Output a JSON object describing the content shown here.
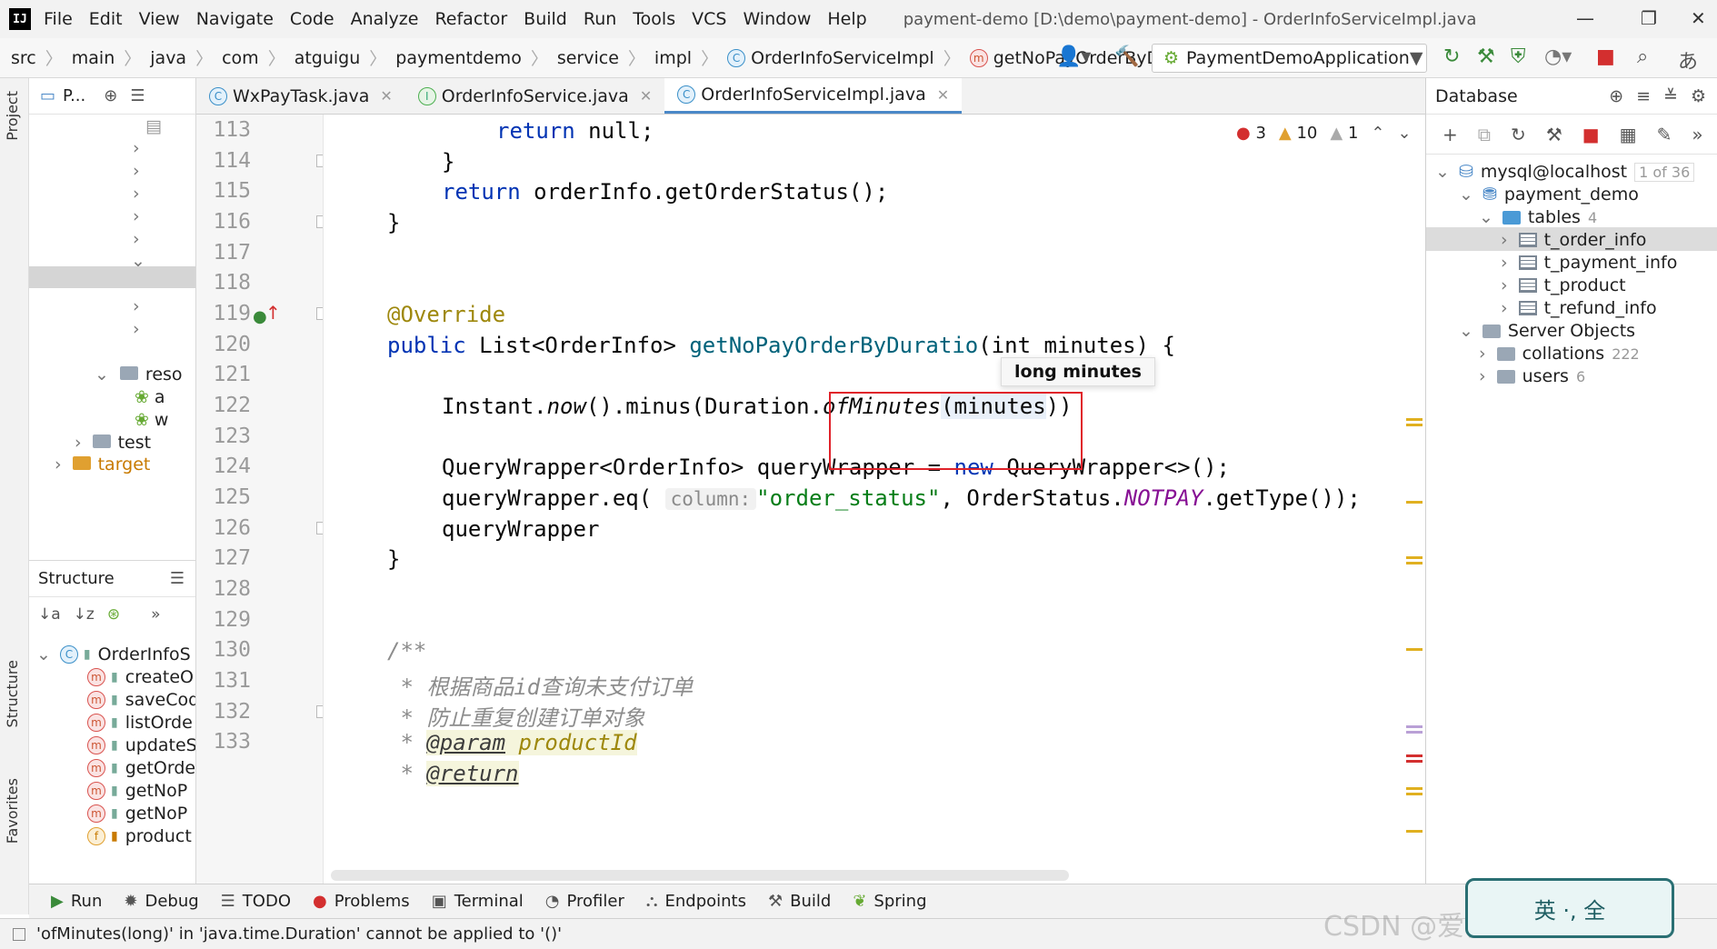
{
  "menubar": {
    "items": [
      "File",
      "Edit",
      "View",
      "Navigate",
      "Code",
      "Analyze",
      "Refactor",
      "Build",
      "Run",
      "Tools",
      "VCS",
      "Window",
      "Help"
    ],
    "title": "payment-demo [D:\\demo\\payment-demo] - OrderInfoServiceImpl.java"
  },
  "breadcrumb": [
    "src",
    "main",
    "java",
    "com",
    "atguigu",
    "paymentdemo",
    "service",
    "impl",
    "OrderInfoServiceImpl",
    "getNoPayOrderByDuration"
  ],
  "run_config": "PaymentDemoApplication",
  "project": {
    "header": "P...",
    "rows": [
      "reso",
      "a",
      "w",
      "test",
      "target"
    ]
  },
  "structure": {
    "header": "Structure",
    "class_name": "OrderInfoS",
    "members": [
      "createO",
      "saveCod",
      "listOrde",
      "updateS",
      "getOrde",
      "getNoP",
      "getNoP",
      "product"
    ]
  },
  "editor_tabs": [
    {
      "label": "WxPayTask.java",
      "badge": "C"
    },
    {
      "label": "OrderInfoService.java",
      "badge": "I"
    },
    {
      "label": "OrderInfoServiceImpl.java",
      "badge": "C"
    }
  ],
  "editor": {
    "line_numbers": [
      "113",
      "114",
      "115",
      "116",
      "117",
      "118",
      "119",
      "120",
      "121",
      "122",
      "123",
      "124",
      "125",
      "126",
      "127",
      "128",
      "129",
      "130",
      "131",
      "132",
      "133"
    ],
    "tooltip": "long minutes",
    "inspections": {
      "errors": "3",
      "warnings": "10",
      "weak": "1"
    },
    "code": {
      "l113_kw": "return",
      "l113_rest": " null;",
      "l114": "}",
      "l115_kw": "return",
      "l115_rest": " orderInfo.getOrderStatus();",
      "l116": "}",
      "l118": "@Override",
      "l119_kw": "public",
      "l119_type": " List<OrderInfo> ",
      "l119_fn": "getNoPayOrderByDuratio",
      "l119_tail": "(int minutes) {",
      "l121_a": "Instant.",
      "l121_now": "now",
      "l121_b": "().minus(Duration.",
      "l121_of": "ofMinutes",
      "l121_c": "(",
      "l121_arg": "minutes",
      "l121_d": "))",
      "l123_a": "QueryWrapper<OrderInfo> queryWrapper = ",
      "l123_kw": "new",
      "l123_b": " QueryWrapper<>();",
      "l124_a": "queryWrapper.eq( ",
      "l124_hint": "column:",
      "l124_str": "\"order_status\"",
      "l124_b": ", OrderStatus.",
      "l124_cst": "NOTPAY",
      "l124_c": ".getType());",
      "l125": "queryWrapper",
      "l126": "}",
      "l129": "/**",
      "l130": " * 根据商品id查询未支付订单",
      "l131": " * 防止重复创建订单对象",
      "l132_a": " * ",
      "l132_tag": "@param",
      "l132_b": " productId",
      "l133_a": " * ",
      "l133_tag": "@return"
    }
  },
  "database": {
    "header": "Database",
    "connection": "mysql@localhost",
    "connection_count": "1 of 36",
    "schema": "payment_demo",
    "tables_label": "tables",
    "tables_count": "4",
    "tables": [
      "t_order_info",
      "t_payment_info",
      "t_product",
      "t_refund_info"
    ],
    "server_objects": "Server Objects",
    "collations": "collations",
    "collations_count": "222",
    "users": "users",
    "users_count": "6"
  },
  "tool_tabs": [
    "Run",
    "Debug",
    "TODO",
    "Problems",
    "Terminal",
    "Profiler",
    "Endpoints",
    "Build",
    "Spring"
  ],
  "status": "'ofMinutes(long)' in 'java.time.Duration' cannot be applied to '()'",
  "watermark": "CSDN @爱伦·千域服务器",
  "ime_label": "英 ·, 全"
}
